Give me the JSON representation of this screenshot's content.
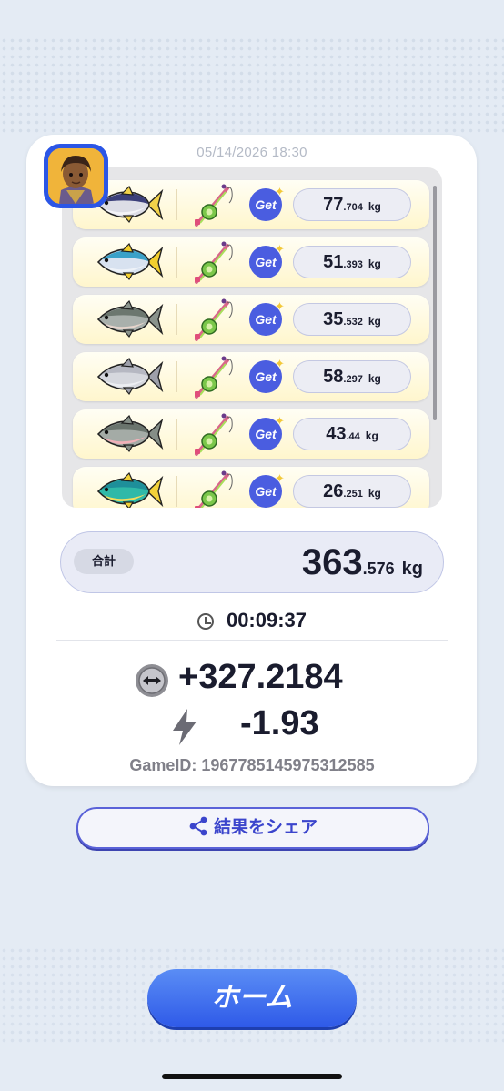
{
  "result": {
    "date": "05/14/2026 18:30",
    "catches": [
      {
        "fish": "tuna-icon",
        "weight_int": "77",
        "weight_dec": ".704",
        "unit": "kg",
        "badge": "Get"
      },
      {
        "fish": "yellowtail-icon",
        "weight_int": "51",
        "weight_dec": ".393",
        "unit": "kg",
        "badge": "Get"
      },
      {
        "fish": "salmon-icon",
        "weight_int": "35",
        "weight_dec": ".532",
        "unit": "kg",
        "badge": "Get"
      },
      {
        "fish": "grouper-icon",
        "weight_int": "58",
        "weight_dec": ".297",
        "unit": "kg",
        "badge": "Get"
      },
      {
        "fish": "trout-icon",
        "weight_int": "43",
        "weight_dec": ".44",
        "unit": "kg",
        "badge": "Get"
      },
      {
        "fish": "mahi-mahi-icon",
        "weight_int": "26",
        "weight_dec": ".251",
        "unit": "kg",
        "badge": "Get"
      }
    ],
    "total_label": "合計",
    "total_int": "363",
    "total_dec": ".576",
    "total_unit": "kg",
    "elapsed": "00:09:37",
    "reward": "+327.2184",
    "energy": "-1.93",
    "game_id": "GameID: 1967785145975312585"
  },
  "actions": {
    "share_label": "結果をシェア",
    "home_label": "ホーム"
  },
  "colors": {
    "accent": "#2f5ae8",
    "card_bg": "#ffffff",
    "row_bg": "#fff6cd"
  }
}
